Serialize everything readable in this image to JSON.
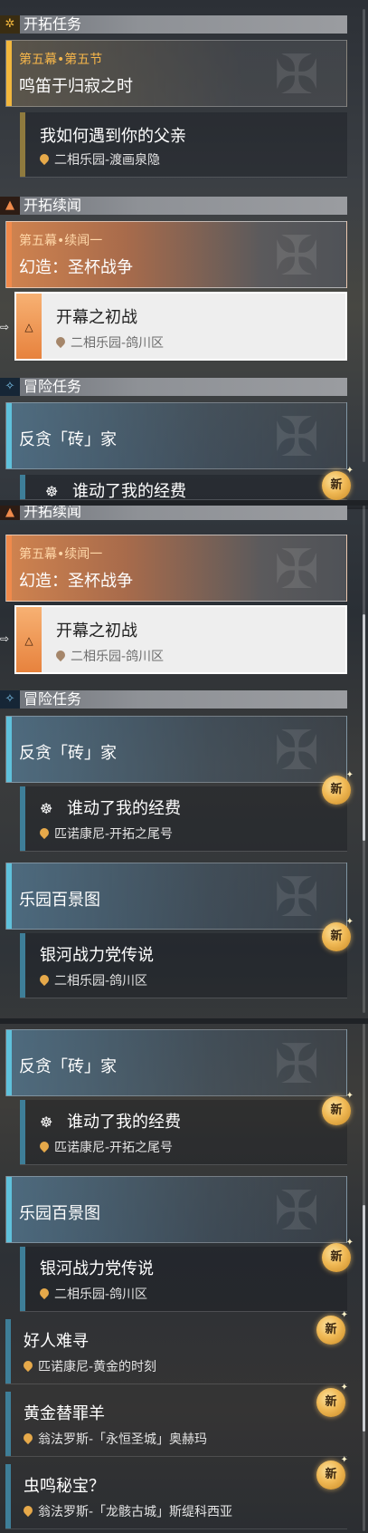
{
  "colors": {
    "gold": "#f2b73d",
    "orange": "#f08a4b",
    "blue": "#7ec9f2",
    "teal": "#3e7e98",
    "selectedBg": "#eeeeee"
  },
  "sections": {
    "trailblaze": {
      "label": "开拓任务",
      "icon": "gear-icon"
    },
    "trailblaze_continued": {
      "label": "开拓续闻",
      "icon": "triangle-icon"
    },
    "adventure": {
      "label": "冒险任务",
      "icon": "diamond-icon"
    }
  },
  "main_quest": {
    "chapter": "第五幕•第五节",
    "title": "鸣笛于归寂之时"
  },
  "main_sub": {
    "title": "我如何遇到你的父亲",
    "location": "二相乐园-渡画泉隐"
  },
  "companion_quest": {
    "chapter": "第五幕•续闻一",
    "title": "幻造：圣杯战争"
  },
  "companion_sub": {
    "title": "开幕之初战",
    "location": "二相乐园-鸽川区"
  },
  "adventure_groups": [
    {
      "title": "反贪「砖」家",
      "sub": {
        "title": "谁动了我的经费",
        "location": "匹诺康尼-开拓之尾号"
      }
    },
    {
      "title": "乐园百景图",
      "sub": {
        "title": "银河战力党传说",
        "location": "二相乐园-鸽川区"
      }
    }
  ],
  "adventure_items": [
    {
      "title": "好人难寻",
      "location": "匹诺康尼-黄金的时刻"
    },
    {
      "title": "黄金替罪羊",
      "location": "翁法罗斯-「永恒圣城」奥赫玛"
    },
    {
      "title": "虫鸣秘宝？",
      "location": "翁法罗斯-「龙骸古城」斯缇科西亚"
    }
  ],
  "badge": {
    "label": "新"
  }
}
